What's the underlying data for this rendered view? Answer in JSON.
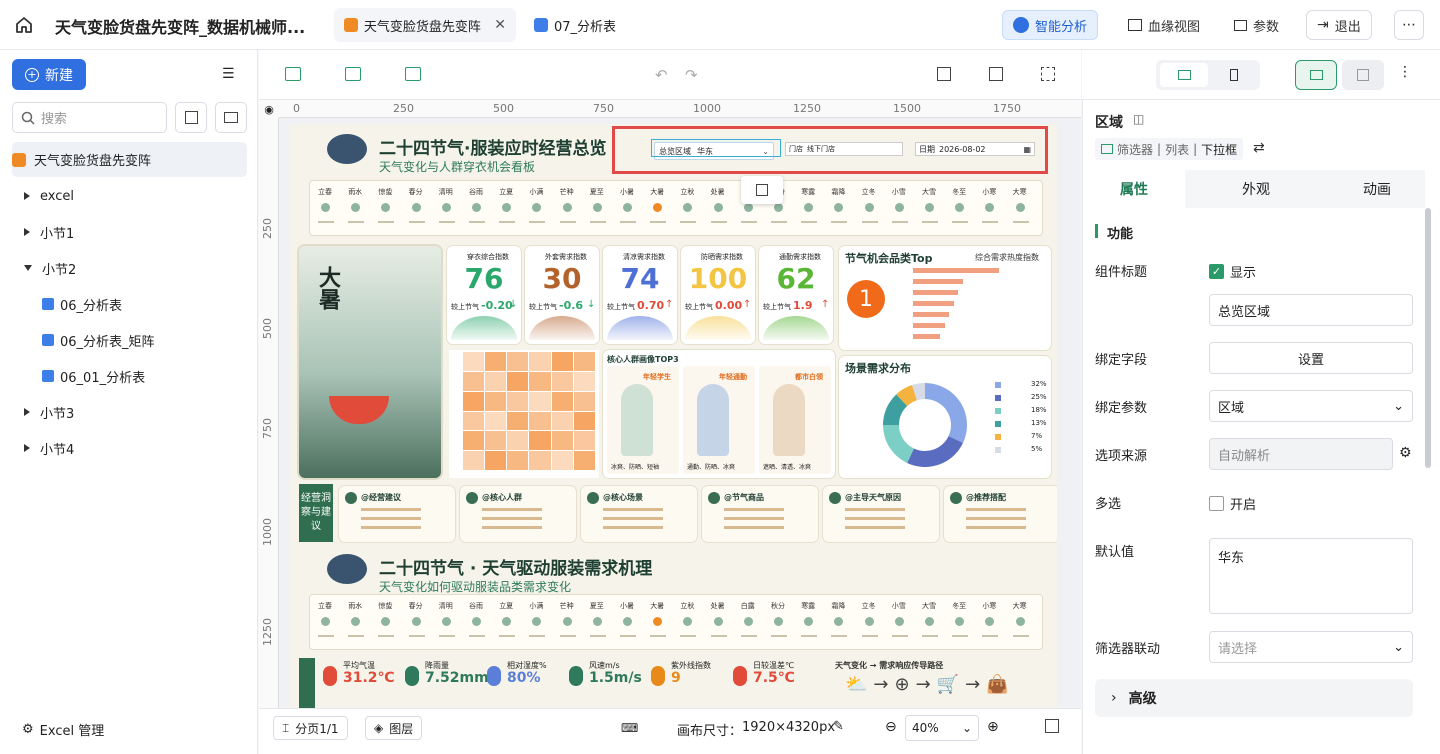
{
  "header": {
    "title": "天气变脸货盘先变阵_数据机械师...",
    "tabs": [
      {
        "label": "天气变脸货盘先变阵",
        "active": true
      },
      {
        "label": "07_分析表",
        "active": false
      }
    ],
    "smart_btn": "智能分析",
    "lineage_btn": "血缘视图",
    "params_btn": "参数",
    "exit_btn": "退出"
  },
  "sidebar": {
    "new_btn": "新建",
    "search_placeholder": "搜索",
    "root": "天气变脸货盘先变阵",
    "items": [
      {
        "label": "excel",
        "indent": 0,
        "kind": "folder"
      },
      {
        "label": "小节1",
        "indent": 0,
        "kind": "folder"
      },
      {
        "label": "小节2",
        "indent": 0,
        "kind": "folder-open"
      },
      {
        "label": "06_分析表",
        "indent": 1,
        "kind": "chart"
      },
      {
        "label": "06_分析表_矩阵",
        "indent": 1,
        "kind": "chart"
      },
      {
        "label": "06_01_分析表",
        "indent": 1,
        "kind": "chart"
      },
      {
        "label": "小节3",
        "indent": 0,
        "kind": "folder"
      },
      {
        "label": "小节4",
        "indent": 0,
        "kind": "folder"
      }
    ],
    "footer": "Excel 管理"
  },
  "ruler": {
    "h": [
      "0",
      "250",
      "500",
      "750",
      "1000",
      "1250",
      "1500",
      "1750"
    ],
    "v": [
      "250",
      "500",
      "750",
      "1000",
      "1250"
    ]
  },
  "canvas_footer": {
    "page_btn": "分页1/1",
    "layer_btn": "图层",
    "size_label": "画布尺寸：",
    "size_value": "1920×4320px",
    "zoom": "40%"
  },
  "panel": {
    "title": "区域",
    "crumb1": "筛选器",
    "crumb2": "列表",
    "crumb3": "下拉框",
    "tabs": [
      "属性",
      "外观",
      "动画"
    ],
    "section": "功能",
    "rows": {
      "title_label": "组件标题",
      "show_label": "显示",
      "title_value": "总览区域",
      "bind_field_label": "绑定字段",
      "bind_field_btn": "设置",
      "bind_param_label": "绑定参数",
      "bind_param_value": "区域",
      "source_label": "选项来源",
      "source_value": "自动解析",
      "multi_label": "多选",
      "multi_value": "开启",
      "default_label": "默认值",
      "default_value": "华东",
      "link_label": "筛选器联动",
      "link_placeholder": "请选择"
    },
    "advanced": "高级"
  },
  "dashboard": {
    "title": "二十四节气·服装应时经营总览",
    "subtitle": "天气变化与人群穿衣机会看板",
    "filter_region_label": "总览区域",
    "filter_region_value": "华东",
    "filter_store_label": "门店",
    "filter_store_value": "线下门店",
    "filter_date_label": "日期",
    "filter_date_value": "2026-08-02",
    "terms": [
      "立春",
      "雨水",
      "惊蛰",
      "春分",
      "清明",
      "谷雨",
      "立夏",
      "小满",
      "芒种",
      "夏至",
      "小暑",
      "大暑",
      "立秋",
      "处暑",
      "白露",
      "秋分",
      "寒露",
      "霜降",
      "立冬",
      "小雪",
      "大雪",
      "冬至",
      "小寒",
      "大寒"
    ],
    "poster_big": "大暑",
    "kpis": [
      {
        "label": "穿衣综合指数",
        "value": "76",
        "delta": "-0.20",
        "sub": "较上节气",
        "color": "#2aa86b",
        "down": true
      },
      {
        "label": "外套需求指数",
        "value": "30",
        "delta": "-0.6",
        "sub": "较上节气",
        "color": "#b4622c",
        "down": true
      },
      {
        "label": "清凉需求指数",
        "value": "74",
        "delta": "0.70",
        "sub": "较上节气",
        "color": "#4d6fd6",
        "down": false
      },
      {
        "label": "防晒需求指数",
        "value": "100",
        "delta": "0.00",
        "sub": "较上节气",
        "color": "#f3c542",
        "down": false
      },
      {
        "label": "通勤需求指数",
        "value": "62",
        "delta": "1.9",
        "sub": "较上节气",
        "color": "#59b636",
        "down": false
      }
    ],
    "top_title": "节气机会品类Top",
    "top_sub": "综合需求热度指数",
    "top_rank": "1",
    "top_bars": [
      0.95,
      0.55,
      0.5,
      0.45,
      0.4,
      0.35,
      0.3
    ],
    "persona_title": "核心人群画像TOP3",
    "personas": [
      "年轻学生",
      "年轻通勤",
      "都市白领"
    ],
    "persona_caps": [
      "冰爽、防晒、短袖",
      "通勤、防晒、冰爽",
      "遮晒、清透、冰爽"
    ],
    "scene_title": "场景需求分布",
    "scene_pcts": [
      "32%",
      "25%",
      "18%",
      "13%",
      "7%",
      "5%"
    ],
    "scene_colors": [
      "#8aa7e8",
      "#5a6cc0",
      "#7ccfc4",
      "#3d9fa0",
      "#f4b23f",
      "#d6dbe8"
    ],
    "scene_values": [
      32,
      25,
      18,
      13,
      7,
      5
    ],
    "advice_label": "经营洞察与建议",
    "advice_cards": [
      "@经营建议",
      "@核心人群",
      "@核心场景",
      "@节气商品",
      "@主导天气原因",
      "@推荐搭配"
    ],
    "sec2_title": "二十四节气 · 天气驱动服装需求机理",
    "sec2_sub": "天气变化如何驱动服装品类需求变化",
    "weather": [
      {
        "label": "平均气温",
        "value": "31.2℃",
        "color": "#e04b3a"
      },
      {
        "label": "降雨量",
        "value": "7.52mm",
        "color": "#2f7a5c"
      },
      {
        "label": "相对湿度%",
        "value": "80%",
        "color": "#5b7fd8"
      },
      {
        "label": "风速m/s",
        "value": "1.5m/s",
        "color": "#2f7a5c"
      },
      {
        "label": "紫外线指数",
        "value": "9",
        "color": "#e88a1a"
      },
      {
        "label": "日较温差℃",
        "value": "7.5℃",
        "color": "#e04b3a"
      }
    ],
    "path_title": "天气变化 → 需求响应传导路径"
  }
}
